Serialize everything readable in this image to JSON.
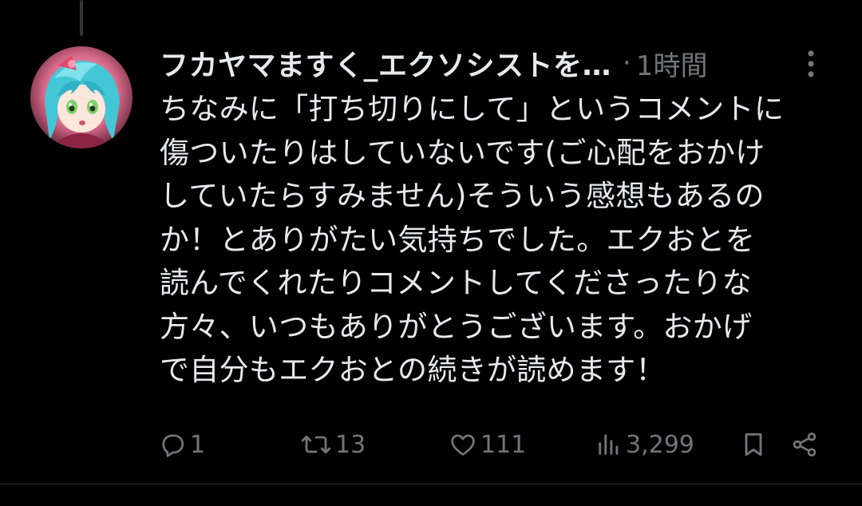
{
  "tweet": {
    "display_name": "フカヤマますく_エクソシストを…",
    "separator": "·",
    "timestamp": "1時間",
    "avatar_icon": "avatar-anime-character-icon",
    "more_icon": "more-vertical-icon",
    "text_lines": [
      "ちなみに「打ち切りにして」というコメントに",
      "傷ついたりはしていないです(ご心配をおかけ",
      "していたらすみません)そういう感想もあるの",
      "か！とありがたい気持ちでした。エクおとを",
      "読んでくれたりコメントしてくださったりな",
      "方々、いつもありがとうございます。おかげ",
      "で自分もエクおとの続きが読めます！"
    ]
  },
  "actions": {
    "reply": {
      "icon": "reply-icon",
      "count": "1"
    },
    "retweet": {
      "icon": "retweet-icon",
      "count": "13"
    },
    "like": {
      "icon": "heart-icon",
      "count": "111"
    },
    "views": {
      "icon": "views-chart-icon",
      "count": "3,299"
    },
    "bookmark": {
      "icon": "bookmark-icon"
    },
    "share": {
      "icon": "share-icon"
    }
  },
  "colors": {
    "background": "#000000",
    "primary_text": "#e7e9ea",
    "secondary_text": "#71767b",
    "divider": "#2f3336"
  }
}
